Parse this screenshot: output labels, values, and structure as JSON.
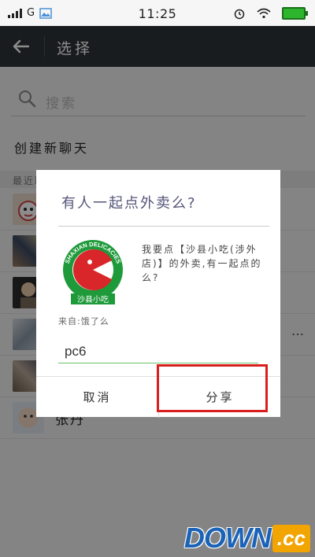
{
  "status_bar": {
    "network": "G",
    "time": "11:25"
  },
  "toolbar": {
    "title": "选择"
  },
  "search": {
    "placeholder": "搜索"
  },
  "new_chat": "创建新聊天",
  "section_header": "最近聊天",
  "contacts": [
    {
      "name": ""
    },
    {
      "name": ""
    },
    {
      "name": ""
    },
    {
      "name": ""
    },
    {
      "name": ""
    },
    {
      "name": "张丹"
    }
  ],
  "dialog": {
    "title": "有人一起点外卖么?",
    "description": "我要点【沙县小吃(涉外店)】的外卖,有一起点的么?",
    "logo_text_top": "SHAXIAN DELICACIES",
    "logo_text_bottom": "沙县小吃",
    "from_label": "来自:饿了么",
    "input_value": "pc6",
    "cancel_label": "取消",
    "share_label": "分享"
  },
  "watermark": {
    "main": "DOWN",
    "suffix": ".cc"
  },
  "colors": {
    "toolbar": "#2f3337",
    "accent_green": "#6cc36c",
    "highlight_red": "#d81e1e"
  }
}
